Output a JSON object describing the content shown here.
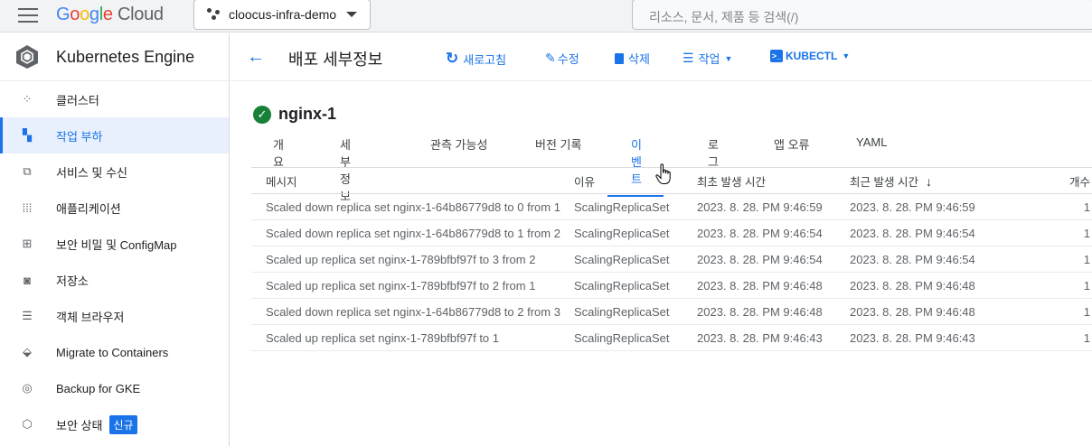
{
  "topbar": {
    "logo_google": "Google",
    "logo_cloud": "Cloud",
    "project": "cloocus-infra-demo",
    "search_placeholder": "리소스, 문서, 제품 등 검색(/)"
  },
  "sidebar": {
    "title": "Kubernetes Engine",
    "items": [
      {
        "label": "클러스터",
        "icon": "cluster-icon"
      },
      {
        "label": "작업 부하",
        "icon": "workloads-icon",
        "active": true
      },
      {
        "label": "서비스 및 수신",
        "icon": "services-icon"
      },
      {
        "label": "애플리케이션",
        "icon": "apps-icon"
      },
      {
        "label": "보안 비밀 및 ConfigMap",
        "icon": "secrets-icon"
      },
      {
        "label": "저장소",
        "icon": "storage-icon"
      },
      {
        "label": "객체 브라우저",
        "icon": "object-browser-icon"
      },
      {
        "label": "Migrate to Containers",
        "icon": "migrate-icon"
      },
      {
        "label": "Backup for GKE",
        "icon": "backup-icon"
      },
      {
        "label": "보안 상태",
        "icon": "security-icon",
        "badge": "신규"
      }
    ]
  },
  "actionbar": {
    "title": "배포 세부정보",
    "refresh": "새로고침",
    "edit": "수정",
    "delete": "삭제",
    "actions": "작업",
    "kubectl": "KUBECTL"
  },
  "resource": {
    "name": "nginx-1",
    "status": "ok"
  },
  "tabs": [
    "개요",
    "세부정보",
    "관측 가능성",
    "버전 기록",
    "이벤트",
    "로그",
    "앱 오류",
    "YAML"
  ],
  "active_tab": "이벤트",
  "events": {
    "columns": [
      "메시지",
      "이유",
      "최초 발생 시간",
      "최근 발생 시간",
      "개수"
    ],
    "rows": [
      [
        "Scaled down replica set nginx-1-64b86779d8 to 0 from 1",
        "ScalingReplicaSet",
        "2023. 8. 28. PM 9:46:59",
        "2023. 8. 28. PM 9:46:59",
        "1"
      ],
      [
        "Scaled down replica set nginx-1-64b86779d8 to 1 from 2",
        "ScalingReplicaSet",
        "2023. 8. 28. PM 9:46:54",
        "2023. 8. 28. PM 9:46:54",
        "1"
      ],
      [
        "Scaled up replica set nginx-1-789bfbf97f to 3 from 2",
        "ScalingReplicaSet",
        "2023. 8. 28. PM 9:46:54",
        "2023. 8. 28. PM 9:46:54",
        "1"
      ],
      [
        "Scaled up replica set nginx-1-789bfbf97f to 2 from 1",
        "ScalingReplicaSet",
        "2023. 8. 28. PM 9:46:48",
        "2023. 8. 28. PM 9:46:48",
        "1"
      ],
      [
        "Scaled down replica set nginx-1-64b86779d8 to 2 from 3",
        "ScalingReplicaSet",
        "2023. 8. 28. PM 9:46:48",
        "2023. 8. 28. PM 9:46:48",
        "1"
      ],
      [
        "Scaled up replica set nginx-1-789bfbf97f to 1",
        "ScalingReplicaSet",
        "2023. 8. 28. PM 9:46:43",
        "2023. 8. 28. PM 9:46:43",
        "1"
      ]
    ]
  },
  "colors": {
    "accent": "#1a73e8",
    "success": "#188038"
  }
}
